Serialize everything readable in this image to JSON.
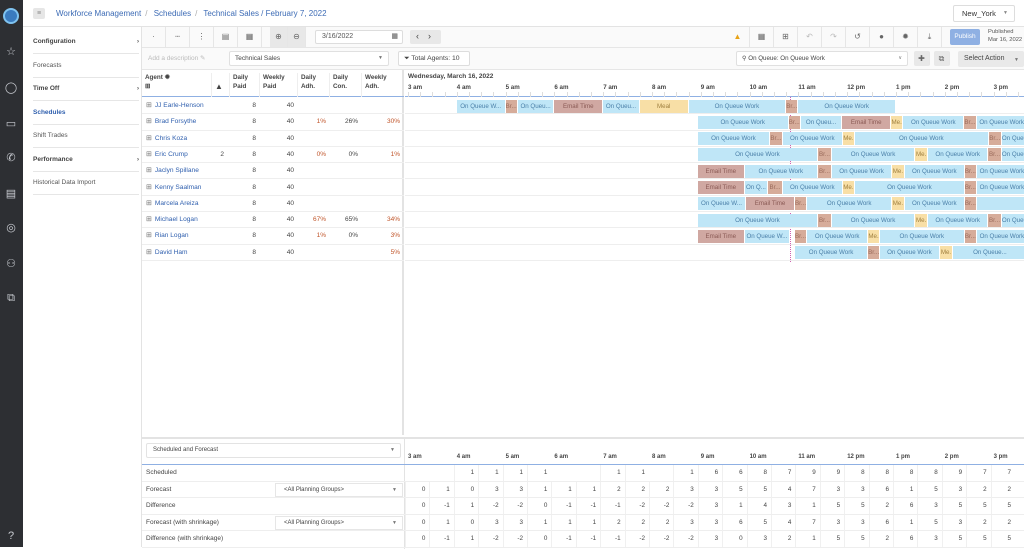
{
  "breadcrumb": [
    "Workforce Management",
    "Schedules",
    "Technical Sales / February 7, 2022"
  ],
  "timezone": "New_York",
  "subnav": [
    {
      "label": "Configuration",
      "bold": true,
      "arrow": true
    },
    {
      "label": "Forecasts",
      "bold": false,
      "arrow": false
    },
    {
      "label": "Time Off",
      "bold": true,
      "arrow": true
    },
    {
      "label": "Schedules",
      "active": true,
      "arrow": false
    },
    {
      "label": "Shift Trades",
      "bold": false,
      "arrow": false
    },
    {
      "label": "Performance",
      "bold": true,
      "arrow": true
    },
    {
      "label": "Historical Data Import",
      "bold": false,
      "arrow": false
    }
  ],
  "toolbar": {
    "date": "3/16/2022",
    "publish": "Publish",
    "published_label": "Published",
    "published_date": "Mar 16, 2022"
  },
  "toolbar2": {
    "description_placeholder": "Add a description",
    "management_unit": "Technical Sales",
    "total_agents": "Total Agents: 10",
    "activity": "On Queue: On Queue Work",
    "select_action": "Select Action"
  },
  "columns": {
    "agent": "Agent",
    "daily_paid": [
      "Daily",
      "Paid"
    ],
    "weekly_paid": [
      "Weekly",
      "Paid"
    ],
    "daily_adh": [
      "Daily",
      "Adh."
    ],
    "daily_con": [
      "Daily",
      "Con."
    ],
    "weekly_adh": [
      "Weekly",
      "Adh."
    ]
  },
  "timeline": {
    "date": "Wednesday, March 16, 2022",
    "hours": [
      "3 am",
      "4 am",
      "5 am",
      "6 am",
      "7 am",
      "8 am",
      "9 am",
      "10 am",
      "11 am",
      "12 pm",
      "1 pm",
      "2 pm",
      "3 pm"
    ]
  },
  "agents": [
    {
      "name": "JJ Earle-Henson",
      "warn": "",
      "daily_paid": "8",
      "weekly_paid": "40",
      "daily_adh": "",
      "daily_con": "",
      "weekly_adh": "",
      "blocks": [
        [
          "oq",
          4.0,
          5.0,
          "On Queue W..."
        ],
        [
          "br",
          5.0,
          5.25,
          "Br..."
        ],
        [
          "oq",
          5.25,
          6.0,
          "On Queu..."
        ],
        [
          "em",
          6.0,
          7.0,
          "Email Time"
        ],
        [
          "oq",
          7.0,
          7.75,
          "On Queu..."
        ],
        [
          "me",
          7.75,
          8.75,
          "Meal"
        ],
        [
          "oq",
          8.75,
          10.75,
          "On Queue Work"
        ],
        [
          "br",
          10.75,
          11.0,
          "Br..."
        ],
        [
          "oq",
          11.0,
          13.0,
          "On Queue Work"
        ]
      ]
    },
    {
      "name": "Brad Forsythe",
      "warn": "",
      "daily_paid": "8",
      "weekly_paid": "40",
      "daily_adh": "1%",
      "daily_con": "26%",
      "weekly_adh": "30%",
      "blocks": [
        [
          "oq",
          8.94,
          10.8,
          "On Queue Work"
        ],
        [
          "br",
          10.8,
          11.05,
          "Br..."
        ],
        [
          "oq",
          11.05,
          11.9,
          "On Queu..."
        ],
        [
          "em",
          11.9,
          12.9,
          "Email Time"
        ],
        [
          "me",
          12.9,
          13.15,
          "Me."
        ],
        [
          "oq",
          13.15,
          14.4,
          "On Queue Work"
        ],
        [
          "br",
          14.4,
          14.65,
          "Br..."
        ],
        [
          "oq",
          14.65,
          15.7,
          "On Queue Work"
        ]
      ]
    },
    {
      "name": "Chris Koza",
      "warn": "",
      "daily_paid": "8",
      "weekly_paid": "40",
      "daily_adh": "",
      "daily_con": "",
      "weekly_adh": "",
      "blocks": [
        [
          "oq",
          8.94,
          10.42,
          "On Queue Work"
        ],
        [
          "br",
          10.42,
          10.68,
          "Br..."
        ],
        [
          "oq",
          10.68,
          11.91,
          "On Queue Work"
        ],
        [
          "me",
          11.91,
          12.16,
          "Me."
        ],
        [
          "oq",
          12.16,
          14.9,
          "On Queue Work"
        ],
        [
          "br",
          14.9,
          15.17,
          "Br..."
        ],
        [
          "oq",
          15.17,
          15.7,
          "On Queue Work"
        ]
      ]
    },
    {
      "name": "Eric Crump",
      "warn": "2",
      "daily_paid": "8",
      "weekly_paid": "40",
      "daily_adh": "0%",
      "daily_con": "0%",
      "weekly_adh": "1%",
      "blocks": [
        [
          "oq",
          8.94,
          11.4,
          "On Queue Work"
        ],
        [
          "br",
          11.4,
          11.69,
          "Br..."
        ],
        [
          "oq",
          11.69,
          13.39,
          "On Queue Work"
        ],
        [
          "me",
          13.39,
          13.66,
          "Me."
        ],
        [
          "oq",
          13.66,
          14.89,
          "On Queue Work"
        ],
        [
          "br",
          14.89,
          15.17,
          "Br..."
        ],
        [
          "oq",
          15.17,
          15.7,
          "On Queue Work"
        ]
      ]
    },
    {
      "name": "Jaclyn Spillane",
      "warn": "",
      "daily_paid": "8",
      "weekly_paid": "40",
      "daily_adh": "",
      "daily_con": "",
      "weekly_adh": "",
      "blocks": [
        [
          "em",
          8.94,
          9.9,
          "Email Time"
        ],
        [
          "oq",
          9.9,
          11.4,
          "On Queue Work"
        ],
        [
          "br",
          11.4,
          11.69,
          "Br..."
        ],
        [
          "oq",
          11.69,
          12.92,
          "On Queue Work"
        ],
        [
          "me",
          12.92,
          13.18,
          "Me."
        ],
        [
          "oq",
          13.18,
          14.41,
          "On Queue Work"
        ],
        [
          "br",
          14.41,
          14.66,
          "Br..."
        ],
        [
          "oq",
          14.66,
          15.7,
          "On Queue Work"
        ]
      ]
    },
    {
      "name": "Kenny Saalman",
      "warn": "",
      "daily_paid": "8",
      "weekly_paid": "40",
      "daily_adh": "",
      "daily_con": "",
      "weekly_adh": "",
      "blocks": [
        [
          "em",
          8.94,
          9.9,
          "Email Time"
        ],
        [
          "oq",
          9.9,
          10.38,
          "On Q..."
        ],
        [
          "br",
          10.38,
          10.68,
          "Br..."
        ],
        [
          "oq",
          10.68,
          11.91,
          "On Queue Work"
        ],
        [
          "me",
          11.91,
          12.16,
          "Me."
        ],
        [
          "oq",
          12.16,
          14.41,
          "On Queue Work"
        ],
        [
          "br",
          14.41,
          14.66,
          "Br..."
        ],
        [
          "oq",
          14.66,
          15.7,
          "On Queue Work"
        ]
      ]
    },
    {
      "name": "Marcela Areiza",
      "warn": "",
      "daily_paid": "8",
      "weekly_paid": "40",
      "daily_adh": "",
      "daily_con": "",
      "weekly_adh": "",
      "blocks": [
        [
          "oq",
          8.94,
          9.93,
          "On Queue W..."
        ],
        [
          "em",
          9.93,
          10.93,
          "Email Time"
        ],
        [
          "br",
          10.93,
          11.18,
          "Br..."
        ],
        [
          "oq",
          11.18,
          12.92,
          "On Queue Work"
        ],
        [
          "me",
          12.92,
          13.18,
          "Me."
        ],
        [
          "oq",
          13.18,
          14.41,
          "On Queue Work"
        ],
        [
          "br",
          14.41,
          14.66,
          "Br..."
        ],
        [
          "oq",
          14.66,
          15.7,
          ""
        ]
      ]
    },
    {
      "name": "Michael Logan",
      "warn": "",
      "daily_paid": "8",
      "weekly_paid": "40",
      "daily_adh": "67%",
      "daily_con": "65%",
      "weekly_adh": "34%",
      "blocks": [
        [
          "oq",
          8.94,
          11.4,
          "On Queue Work"
        ],
        [
          "br",
          11.4,
          11.69,
          "Br..."
        ],
        [
          "oq",
          11.69,
          13.39,
          "On Queue Work"
        ],
        [
          "me",
          13.39,
          13.66,
          "Me."
        ],
        [
          "oq",
          13.66,
          14.89,
          "On Queue Work"
        ],
        [
          "br",
          14.89,
          15.17,
          "Br..."
        ],
        [
          "oq",
          15.17,
          15.7,
          "On Queue Work"
        ]
      ]
    },
    {
      "name": "Rian Logan",
      "warn": "",
      "daily_paid": "8",
      "weekly_paid": "40",
      "daily_adh": "1%",
      "daily_con": "0%",
      "weekly_adh": "3%",
      "blocks": [
        [
          "em",
          8.94,
          9.9,
          "Email Time"
        ],
        [
          "oq",
          9.9,
          10.83,
          "On Queue W..."
        ],
        [
          "br",
          10.93,
          11.18,
          "Br..."
        ],
        [
          "oq",
          11.18,
          12.43,
          "On Queue Work"
        ],
        [
          "me",
          12.43,
          12.67,
          "Me."
        ],
        [
          "oq",
          12.67,
          14.41,
          "On Queue Work"
        ],
        [
          "br",
          14.41,
          14.66,
          "Br..."
        ],
        [
          "oq",
          14.66,
          15.7,
          "On Queue Work"
        ]
      ]
    },
    {
      "name": "David Ham",
      "warn": "",
      "daily_paid": "8",
      "weekly_paid": "40",
      "daily_adh": "",
      "daily_con": "",
      "weekly_adh": "5%",
      "blocks": [
        [
          "oq",
          10.93,
          12.43,
          "On Queue Work"
        ],
        [
          "br",
          12.43,
          12.67,
          "Br..."
        ],
        [
          "oq",
          12.67,
          13.9,
          "On Queue Work"
        ],
        [
          "me",
          13.9,
          14.17,
          "Me."
        ],
        [
          "oq",
          14.17,
          15.7,
          "On Queue..."
        ]
      ]
    }
  ],
  "bottom": {
    "view": "Scheduled and Forecast",
    "rows": [
      {
        "label": "Scheduled",
        "group": "",
        "values": [
          "",
          "",
          "1",
          "1",
          "1",
          "1",
          "",
          "",
          "1",
          "1",
          "",
          "1",
          "6",
          "6",
          "8",
          "7",
          "9",
          "9",
          "8",
          "8",
          "8",
          "8",
          "9",
          "7",
          "7"
        ]
      },
      {
        "label": "Forecast",
        "group": "<All Planning Groups>",
        "values": [
          "0",
          "1",
          "0",
          "3",
          "3",
          "1",
          "1",
          "1",
          "2",
          "2",
          "2",
          "3",
          "3",
          "5",
          "5",
          "4",
          "7",
          "3",
          "3",
          "6",
          "1",
          "5",
          "3",
          "2",
          "2"
        ]
      },
      {
        "label": "Difference",
        "group": "",
        "values": [
          "0",
          "-1",
          "1",
          "-2",
          "-2",
          "0",
          "-1",
          "-1",
          "-1",
          "-2",
          "-2",
          "-2",
          "3",
          "1",
          "4",
          "3",
          "1",
          "5",
          "5",
          "2",
          "6",
          "3",
          "5",
          "5",
          "5"
        ]
      },
      {
        "label": "Forecast (with shrinkage)",
        "group": "<All Planning Groups>",
        "values": [
          "0",
          "1",
          "0",
          "3",
          "3",
          "1",
          "1",
          "1",
          "2",
          "2",
          "2",
          "3",
          "3",
          "6",
          "5",
          "4",
          "7",
          "3",
          "3",
          "6",
          "1",
          "5",
          "3",
          "2",
          "2"
        ]
      },
      {
        "label": "Difference (with shrinkage)",
        "group": "",
        "values": [
          "0",
          "-1",
          "1",
          "-2",
          "-2",
          "0",
          "-1",
          "-1",
          "-1",
          "-2",
          "-2",
          "-2",
          "3",
          "0",
          "3",
          "2",
          "1",
          "5",
          "5",
          "2",
          "6",
          "3",
          "5",
          "5",
          "5"
        ]
      }
    ]
  }
}
